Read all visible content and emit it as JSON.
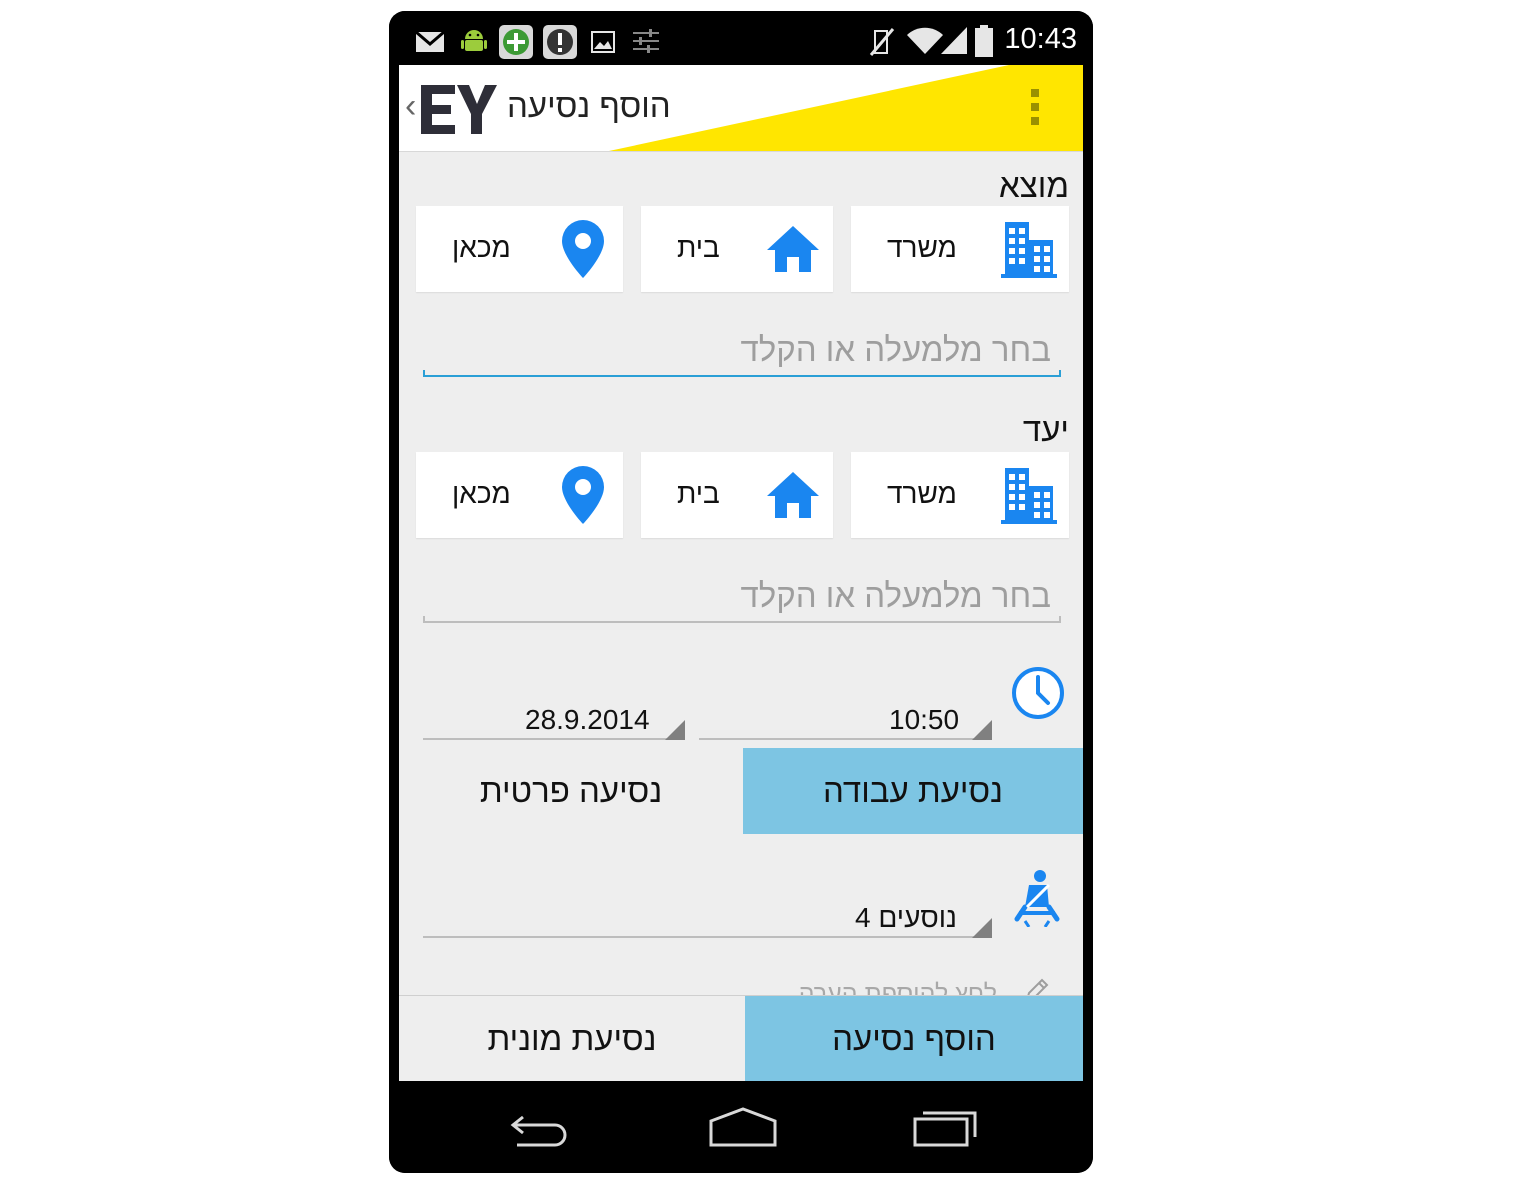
{
  "status_bar": {
    "time": "10:43",
    "icons": [
      "mail-icon",
      "android-icon",
      "plus-icon",
      "alert-icon",
      "image-icon",
      "settings-sliders-icon",
      "mute-icon",
      "wifi-icon",
      "signal-icon",
      "battery-icon"
    ]
  },
  "app_bar": {
    "back": "‹",
    "logo": "EY",
    "title": "הוסף נסיעה",
    "menu_icon": "overflow-menu-icon"
  },
  "origin": {
    "label": "מוצא",
    "buttons": [
      {
        "label": "משרד",
        "icon": "office-building-icon"
      },
      {
        "label": "בית",
        "icon": "home-icon"
      },
      {
        "label": "מכאן",
        "icon": "location-pin-icon"
      }
    ],
    "placeholder": "בחר מלמעלה או הקלד"
  },
  "destination": {
    "label": "יעד",
    "buttons": [
      {
        "label": "משרד",
        "icon": "office-building-icon"
      },
      {
        "label": "בית",
        "icon": "home-icon"
      },
      {
        "label": "מכאן",
        "icon": "location-pin-icon"
      }
    ],
    "placeholder": "בחר מלמעלה או הקלד"
  },
  "schedule": {
    "time": "10:50",
    "date": "28.9.2014",
    "icon": "clock-icon"
  },
  "trip_type": {
    "work": "נסיעת עבודה",
    "private": "נסיעה פרטית",
    "selected": "work"
  },
  "passengers": {
    "value": "4 נוסעים",
    "icon": "seatbelt-icon"
  },
  "note": {
    "text": "לחץ להוספת הערה",
    "icon": "pencil-icon"
  },
  "actions": {
    "taxi": "נסיעת מונית",
    "add": "הוסף נסיעה"
  },
  "colors": {
    "accent_blue": "#7dc5e3",
    "icon_blue": "#1a86f0",
    "brand_yellow": "#ffe600",
    "focus_line": "#2a9fd6"
  }
}
